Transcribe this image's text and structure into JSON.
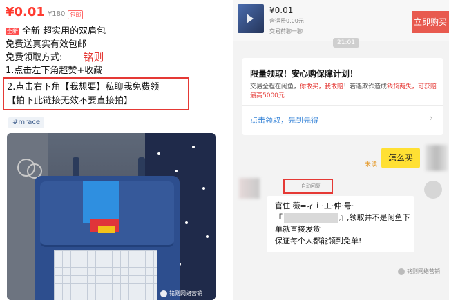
{
  "listing": {
    "price": "¥0.01",
    "original_price": "¥180",
    "shipping_badge": "包邮",
    "new_badge": "全新",
    "title_line": "全新 超实用的双肩包",
    "line2": "免费送真实有效包邮",
    "line3": "免费领取方式:",
    "signature": "铭则",
    "line4": "1.点击左下角超赞+收藏",
    "line5": "2.点击右下角【我想要】私聊我免费领",
    "line6": "【拍下此链接无效不要直接拍】",
    "hashtag": "#mrace",
    "watermark": "铭则网络营销"
  },
  "chat": {
    "product_price": "¥0.01",
    "shipping": "含运费0.00元",
    "trade_status": "交易前聊一聊",
    "buy_button": "立即购买",
    "timestamp": "21:01",
    "guarantee": {
      "title": "限量领取！安心购保障计划！",
      "text_before": "交易全程在闲鱼，",
      "text_red1": "你敢买，我敢赔",
      "text_mid": "！若遇欺诈造成",
      "text_red2": "钱货两失，可获赔最高5000元",
      "link": "点击领取，先到先得",
      "chevron": "›"
    },
    "unread_label": "未读",
    "my_message": "怎么买",
    "auto_reply_label": "自动回复",
    "reply_line1": "官住 薇=ィ ἰ ·工·仲·号·",
    "reply_line2_prefix": "『",
    "reply_line2_suffix": "』,领取并不是闲鱼下",
    "reply_line3": "单就直接发货",
    "reply_line4": "保证每个人都能领到免单!",
    "watermark": "铭则网络营销"
  }
}
